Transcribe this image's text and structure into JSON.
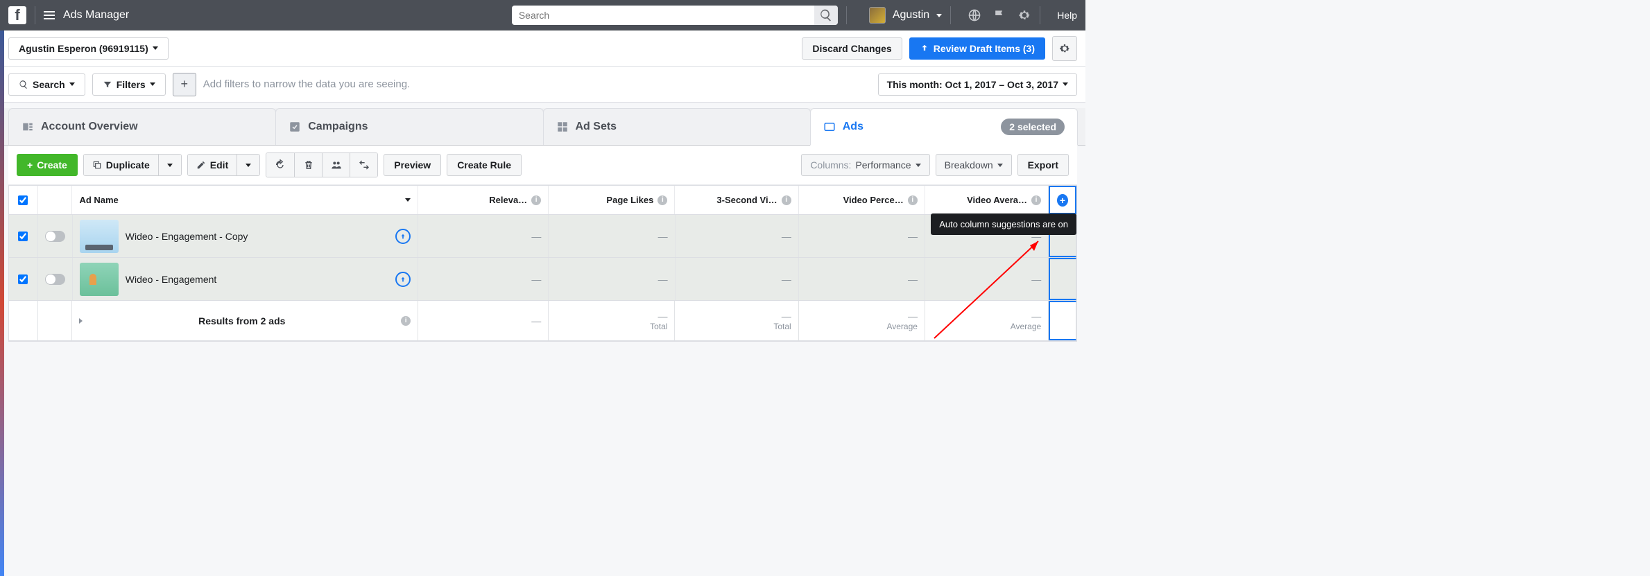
{
  "topbar": {
    "title": "Ads Manager",
    "search_placeholder": "Search",
    "user_name": "Agustin",
    "help": "Help"
  },
  "subbar": {
    "account_label": "Agustin Esperon (96919115)",
    "discard": "Discard Changes",
    "review": "Review Draft Items (3)"
  },
  "filterbar": {
    "search": "Search",
    "filters": "Filters",
    "hint": "Add filters to narrow the data you are seeing.",
    "date": "This month: Oct 1, 2017 – Oct 3, 2017"
  },
  "tabs": {
    "overview": "Account Overview",
    "campaigns": "Campaigns",
    "adsets": "Ad Sets",
    "ads": "Ads",
    "selected": "2 selected"
  },
  "toolbar": {
    "create": "Create",
    "duplicate": "Duplicate",
    "edit": "Edit",
    "preview": "Preview",
    "create_rule": "Create Rule",
    "columns_lbl": "Columns:",
    "columns_val": "Performance",
    "breakdown": "Breakdown",
    "export": "Export"
  },
  "table": {
    "headers": {
      "name": "Ad Name",
      "c1": "Releva…",
      "c2": "Page Likes",
      "c3": "3-Second Vi…",
      "c4": "Video Perce…",
      "c5": "Video Avera…"
    },
    "rows": [
      {
        "name": "Wideo - Engagement - Copy",
        "c1": "—",
        "c2": "—",
        "c3": "—",
        "c4": "—",
        "c5": "—"
      },
      {
        "name": "Wideo - Engagement",
        "c1": "—",
        "c2": "—",
        "c3": "—",
        "c4": "—",
        "c5": "—"
      }
    ],
    "summary": {
      "label": "Results from 2 ads",
      "c1": "—",
      "c2": {
        "val": "—",
        "sub": "Total"
      },
      "c3": {
        "val": "—",
        "sub": "Total"
      },
      "c4": {
        "val": "—",
        "sub": "Average"
      },
      "c5": {
        "val": "—",
        "sub": "Average"
      }
    }
  },
  "tooltip": "Auto column suggestions are on"
}
